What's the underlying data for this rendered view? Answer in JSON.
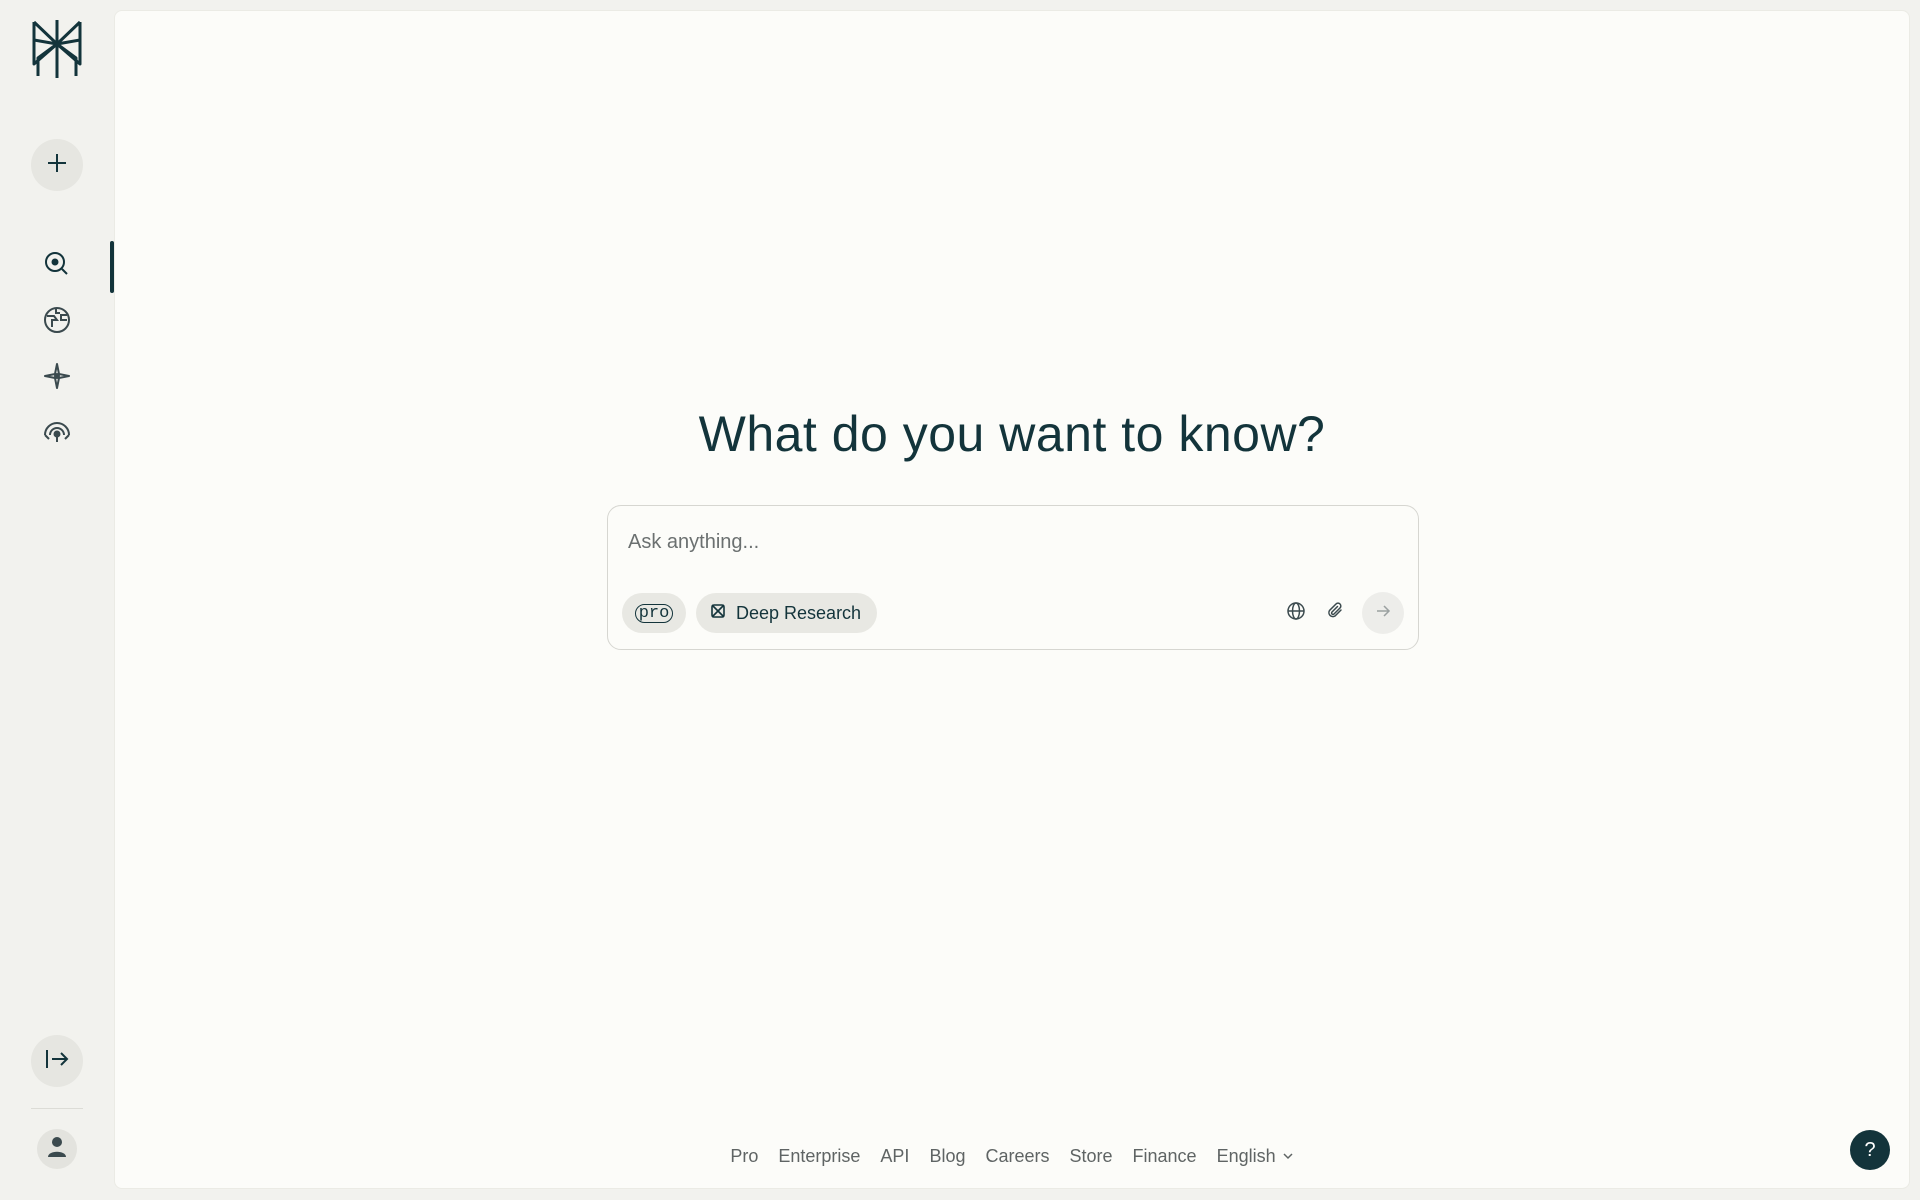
{
  "sidebar": {
    "logo": "perplexity-logo",
    "new_thread_icon": "plus-icon",
    "nav_items": [
      {
        "icon": "search-icon",
        "active": true
      },
      {
        "icon": "globe-icon",
        "active": false
      },
      {
        "icon": "sparkle-icon",
        "active": false
      },
      {
        "icon": "spaces-icon",
        "active": false
      }
    ],
    "collapse_icon": "expand-sidebar-icon",
    "profile_icon": "user-icon"
  },
  "main": {
    "headline": "What do you want to know?",
    "search": {
      "placeholder": "Ask anything...",
      "value": "",
      "pro_label": "pro",
      "deep_research_label": "Deep Research",
      "source_icon": "globe-icon",
      "attach_icon": "paperclip-icon",
      "submit_icon": "arrow-right-icon"
    }
  },
  "footer": {
    "links": [
      "Pro",
      "Enterprise",
      "API",
      "Blog",
      "Careers",
      "Store",
      "Finance"
    ],
    "language": "English"
  },
  "help": {
    "label": "?"
  },
  "colors": {
    "accent": "#13343b",
    "background": "#fcfcf9",
    "sidebar": "#f2f2ee"
  }
}
